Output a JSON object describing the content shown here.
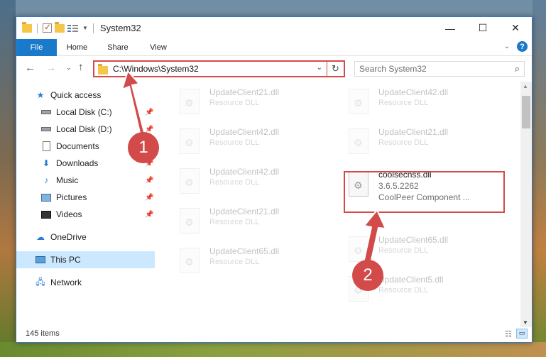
{
  "window": {
    "title": "System32",
    "controls": {
      "minimize": "—",
      "maximize": "☐",
      "close": "✕"
    }
  },
  "ribbon": {
    "tabs": [
      "File",
      "Home",
      "Share",
      "View"
    ],
    "help": "?"
  },
  "nav": {
    "address": "C:\\Windows\\System32",
    "search_placeholder": "Search System32"
  },
  "sidebar": {
    "items": [
      {
        "label": "Quick access",
        "icon": "star-icon",
        "pinned": false
      },
      {
        "label": "Local Disk (C:)",
        "icon": "drive-icon",
        "pinned": true
      },
      {
        "label": "Local Disk (D:)",
        "icon": "drive-icon",
        "pinned": true
      },
      {
        "label": "Documents",
        "icon": "documents-icon",
        "pinned": true
      },
      {
        "label": "Downloads",
        "icon": "download-icon",
        "pinned": true
      },
      {
        "label": "Music",
        "icon": "music-icon",
        "pinned": true
      },
      {
        "label": "Pictures",
        "icon": "pictures-icon",
        "pinned": true
      },
      {
        "label": "Videos",
        "icon": "videos-icon",
        "pinned": true
      },
      {
        "label": "OneDrive",
        "icon": "cloud-icon",
        "pinned": false
      },
      {
        "label": "This PC",
        "icon": "computer-icon",
        "pinned": false,
        "selected": true
      },
      {
        "label": "Network",
        "icon": "network-icon",
        "pinned": false
      }
    ]
  },
  "files": {
    "left_column": [
      {
        "name": "UpdateClient21.dll",
        "type": "Resource DLL"
      },
      {
        "name": "UpdateClient42.dll",
        "type": "Resource DLL"
      },
      {
        "name": "UpdateClient42.dll",
        "type": "Resource DLL"
      },
      {
        "name": "UpdateClient21.dll",
        "type": "Resource DLL"
      },
      {
        "name": "UpdateClient65.dll",
        "type": "Resource DLL"
      }
    ],
    "right_column": [
      {
        "name": "UpdateClient42.dll",
        "type": "Resource DLL"
      },
      {
        "name": "UpdateClient21.dll",
        "type": "Resource DLL"
      },
      {
        "name": "UpdateClient65.dll",
        "type": "Resource DLL"
      },
      {
        "name": "UpdateClient5.dll",
        "type": "Resource DLL"
      }
    ],
    "highlighted": {
      "name": "coolsecnss.dll",
      "version": "3.6.5.2262",
      "company": "CoolPeer Component ..."
    }
  },
  "status": {
    "item_count": "145 items"
  },
  "callouts": {
    "one": "1",
    "two": "2"
  },
  "colors": {
    "accent": "#1979ca",
    "highlight": "#d24a4a",
    "selected": "#cce8ff"
  }
}
